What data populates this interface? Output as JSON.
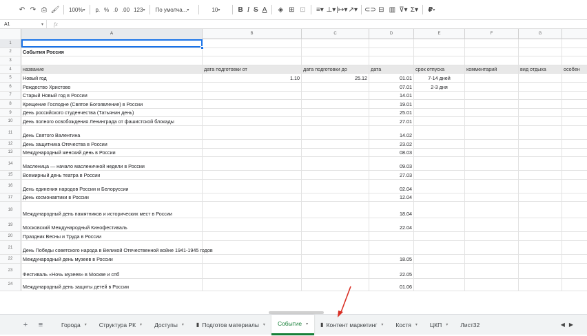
{
  "toolbar": {
    "undo_icon": "undo-icon",
    "redo_icon": "redo-icon",
    "print_icon": "print-icon",
    "paint_format_icon": "paint-format-icon",
    "zoom": "100%",
    "currency": "р.",
    "percent": "%",
    "dec_decrease": ".0",
    "dec_increase": ".00",
    "more_formats": "123",
    "font": "По умолча...",
    "font_size": "10",
    "bold": "B",
    "italic": "I",
    "strike": "S",
    "text_color": "A",
    "currency_alt": "₽"
  },
  "formula_bar": {
    "cell_ref": "A1",
    "fx": "fx",
    "content": ""
  },
  "columns": [
    "A",
    "B",
    "C",
    "D",
    "E",
    "F",
    "G"
  ],
  "rows": [
    {
      "n": "1",
      "cells": [
        "",
        "",
        "",
        "",
        "",
        "",
        "",
        ""
      ]
    },
    {
      "n": "2",
      "cells": [
        "События Россия",
        "",
        "",
        "",
        "",
        "",
        "",
        ""
      ]
    },
    {
      "n": "3",
      "cells": [
        "",
        "",
        "",
        "",
        "",
        "",
        "",
        ""
      ]
    },
    {
      "n": "4",
      "cells": [
        "название",
        "дата подготовки от",
        "дата подготовки до",
        "дата",
        "срок отпуска",
        "комментарий",
        "вид отдыха",
        "особен"
      ]
    },
    {
      "n": "5",
      "cells": [
        "Новый год",
        "1.10",
        "25.12",
        "01.01",
        "7-14 дней",
        "",
        "",
        ""
      ]
    },
    {
      "n": "6",
      "cells": [
        "Рождество Христово",
        "",
        "",
        "07.01",
        "2-3 дня",
        "",
        "",
        ""
      ]
    },
    {
      "n": "7",
      "cells": [
        "Старый Новый год в России",
        "",
        "",
        "14.01",
        "",
        "",
        "",
        ""
      ]
    },
    {
      "n": "8",
      "cells": [
        "Крещение Господне (Святое Богоявление) в России",
        "",
        "",
        "19.01",
        "",
        "",
        "",
        ""
      ]
    },
    {
      "n": "9",
      "cells": [
        "День российского студенчества (Татьянин день)",
        "",
        "",
        "25.01",
        "",
        "",
        "",
        ""
      ]
    },
    {
      "n": "10",
      "cells": [
        "День полного освобождения Ленинграда от фашистской блокады",
        "",
        "",
        "27.01",
        "",
        "",
        "",
        ""
      ]
    },
    {
      "n": "11",
      "cells": [
        "День Святого Валентина",
        "",
        "",
        "14.02",
        "",
        "",
        "",
        ""
      ]
    },
    {
      "n": "12",
      "cells": [
        "День защитника Отечества в России",
        "",
        "",
        "23.02",
        "",
        "",
        "",
        ""
      ]
    },
    {
      "n": "13",
      "cells": [
        "Международный женский день в России",
        "",
        "",
        "08.03",
        "",
        "",
        "",
        ""
      ]
    },
    {
      "n": "14",
      "cells": [
        "Масленица — начало масленичной недели в России",
        "",
        "",
        "09.03",
        "",
        "",
        "",
        ""
      ]
    },
    {
      "n": "15",
      "cells": [
        "Всемирный день театра в России",
        "",
        "",
        "27.03",
        "",
        "",
        "",
        ""
      ]
    },
    {
      "n": "16",
      "cells": [
        "День единения народов России и Белоруссии",
        "",
        "",
        "02.04",
        "",
        "",
        "",
        ""
      ]
    },
    {
      "n": "17",
      "cells": [
        "День космонавтики в России",
        "",
        "",
        "12.04",
        "",
        "",
        "",
        ""
      ]
    },
    {
      "n": "18",
      "cells": [
        "Международный день памятников и исторических мест в России",
        "",
        "",
        "18.04",
        "",
        "",
        "",
        ""
      ]
    },
    {
      "n": "19",
      "cells": [
        "Московский Международный Кинофестиваль",
        "",
        "",
        "22.04",
        "",
        "",
        "",
        ""
      ]
    },
    {
      "n": "20",
      "cells": [
        "Праздник Весны и Труда в России",
        "",
        "",
        "",
        "",
        "",
        "",
        ""
      ]
    },
    {
      "n": "21",
      "cells": [
        "День Победы советского народа в Великой Отечественной войне 1941-1945 годов",
        "",
        "",
        "",
        "",
        "",
        "",
        ""
      ]
    },
    {
      "n": "22",
      "cells": [
        "Международный день музеев в России",
        "",
        "",
        "18.05",
        "",
        "",
        "",
        ""
      ]
    },
    {
      "n": "23",
      "cells": [
        "Фестиваль «Ночь музеев» в Москве и спб",
        "",
        "",
        "22.05",
        "",
        "",
        "",
        ""
      ]
    },
    {
      "n": "24",
      "cells": [
        "Международный день защиты детей в России",
        "",
        "",
        "01.06",
        "",
        "",
        "",
        ""
      ]
    }
  ],
  "tabs": [
    {
      "label": "Города",
      "icon": ""
    },
    {
      "label": "Структура РК",
      "icon": ""
    },
    {
      "label": "Доступы",
      "icon": ""
    },
    {
      "label": "Подготов материалы",
      "icon": "sheet-lock-icon"
    },
    {
      "label": "Событие",
      "icon": "",
      "active": true
    },
    {
      "label": "Контент маркетинг",
      "icon": "sheet-lock-icon"
    },
    {
      "label": "Костя",
      "icon": ""
    },
    {
      "label": "ЦКП",
      "icon": ""
    },
    {
      "label": "Лист32",
      "icon": ""
    }
  ],
  "tabbar": {
    "add_icon": "+",
    "all_sheets_icon": "≡"
  },
  "colors": {
    "accent_blue": "#1a73e8",
    "active_tab_green": "#188038",
    "header_row_bg": "#e8e8e8",
    "arrow_red": "#d93025"
  }
}
